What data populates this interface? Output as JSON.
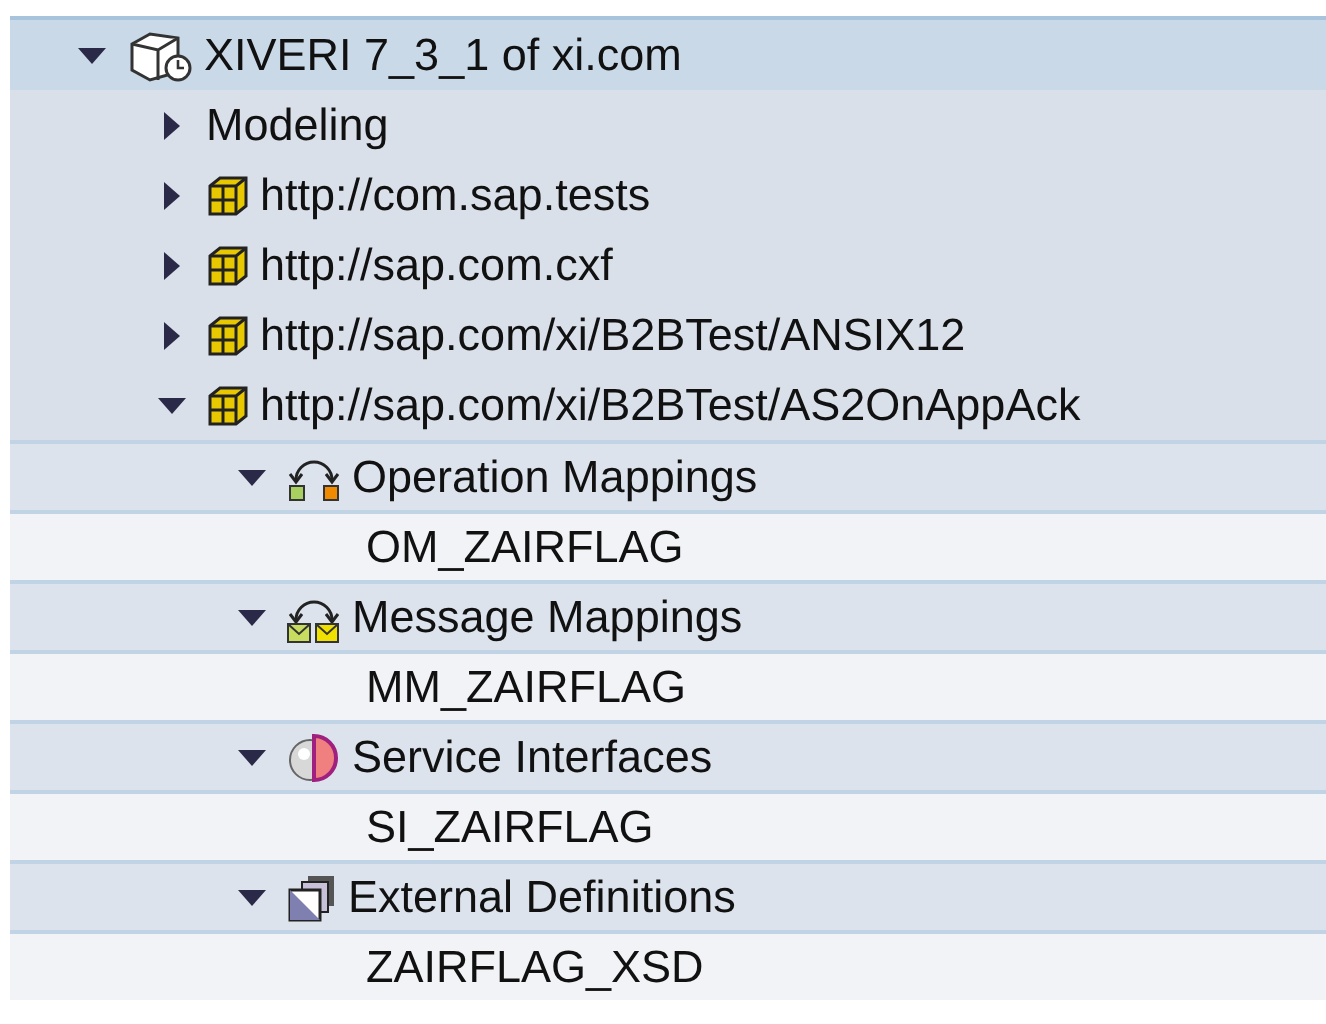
{
  "tree": [
    {
      "label": "XIVERI 7_3_1 of xi.com",
      "kind": "component",
      "expanded": true,
      "children": [
        {
          "label": "Modeling",
          "kind": "folder",
          "expanded": false
        },
        {
          "label": "http://com.sap.tests",
          "kind": "namespace",
          "expanded": false
        },
        {
          "label": "http://sap.com.cxf",
          "kind": "namespace",
          "expanded": false
        },
        {
          "label": "http://sap.com/xi/B2BTest/ANSIX12",
          "kind": "namespace",
          "expanded": false
        },
        {
          "label": "http://sap.com/xi/B2BTest/AS2OnAppAck",
          "kind": "namespace",
          "expanded": true,
          "children": [
            {
              "label": "Operation Mappings",
              "kind": "operation-mapping",
              "expanded": true,
              "children": [
                {
                  "label": "OM_ZAIRFLAG"
                }
              ]
            },
            {
              "label": "Message Mappings",
              "kind": "message-mapping",
              "expanded": true,
              "children": [
                {
                  "label": "MM_ZAIRFLAG"
                }
              ]
            },
            {
              "label": "Service Interfaces",
              "kind": "service-interface",
              "expanded": true,
              "children": [
                {
                  "label": "SI_ZAIRFLAG"
                }
              ]
            },
            {
              "label": "External Definitions",
              "kind": "external-definition",
              "expanded": true,
              "children": [
                {
                  "label": "ZAIRFLAG_XSD"
                }
              ]
            }
          ]
        }
      ]
    }
  ]
}
